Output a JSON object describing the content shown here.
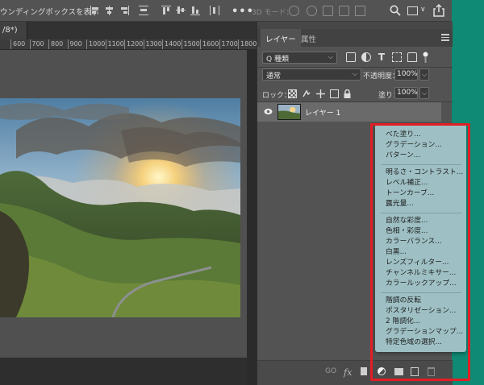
{
  "options_bar": {
    "align_label": "ウンディングボックスを表示",
    "more_label": "•••",
    "mode_3d_label": "3D モード："
  },
  "document": {
    "tab_title": "/8*)",
    "ruler_ticks": [
      "600",
      "700",
      "800",
      "900",
      "1000",
      "1100",
      "1200",
      "1300",
      "1400",
      "1500",
      "1600",
      "1700",
      "1800"
    ]
  },
  "panel": {
    "tabs": [
      "レイヤー",
      "属性"
    ],
    "filter": {
      "value": "Q 種類"
    },
    "blend_mode": "通常",
    "opacity_label": "不透明度：",
    "opacity_value": "100%",
    "lock_label": "ロック：",
    "fill_label": "塗り：",
    "fill_value": "100%",
    "layer": {
      "name": "レイヤー 1"
    }
  },
  "footer": {
    "link_label": "GO",
    "fx_label": "fx"
  },
  "adjustments_menu": {
    "groups": [
      [
        "べた塗り...",
        "グラデーション...",
        "パターン..."
      ],
      [
        "明るさ・コントラスト...",
        "レベル補正...",
        "トーンカーブ...",
        "露光量..."
      ],
      [
        "自然な彩度...",
        "色相・彩度...",
        "カラーバランス...",
        "白黒...",
        "レンズフィルター...",
        "チャンネルミキサー...",
        "カラールックアップ..."
      ],
      [
        "階調の反転",
        "ポスタリゼーション...",
        "2 階調化...",
        "グラデーションマップ...",
        "特定色域の選択..."
      ]
    ]
  },
  "colors": {
    "highlight": "#e21e25",
    "menu_bg": "#9ec0c4",
    "desktop": "#0f8a74"
  }
}
